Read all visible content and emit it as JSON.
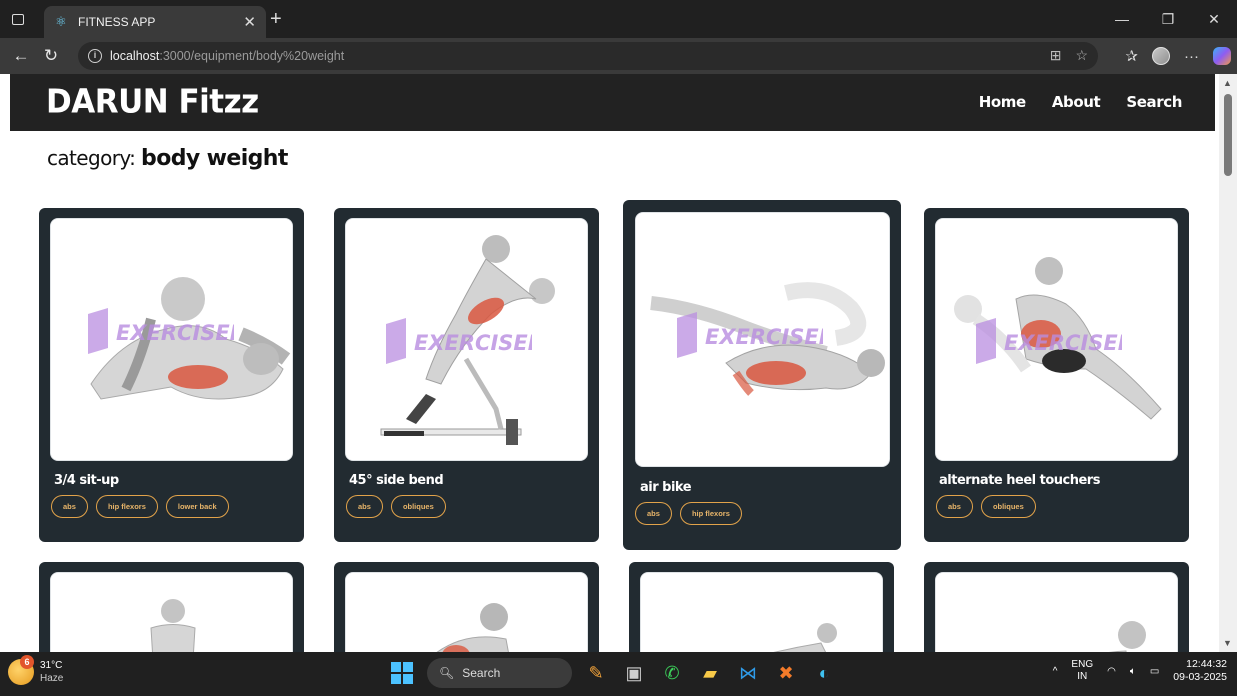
{
  "browser": {
    "tab_title": "FITNESS APP",
    "url_host": "localhost",
    "url_path": ":3000/equipment/body%20weight"
  },
  "app": {
    "brand": "DARUN Fitzz",
    "nav": [
      "Home",
      "About",
      "Search"
    ],
    "heading_prefix": "category:",
    "heading_value": "body weight",
    "watermark": "EXERCISEDB"
  },
  "cards": [
    {
      "name": "3/4 sit-up",
      "tags": [
        "abs",
        "hip flexors",
        "lower back"
      ]
    },
    {
      "name": "45° side bend",
      "tags": [
        "abs",
        "obliques"
      ]
    },
    {
      "name": "air bike",
      "tags": [
        "abs",
        "hip flexors"
      ]
    },
    {
      "name": "alternate heel touchers",
      "tags": [
        "abs",
        "obliques"
      ]
    }
  ],
  "taskbar": {
    "temperature": "31°C",
    "weather": "Haze",
    "weather_badge": "6",
    "search": "Search",
    "lang_top": "ENG",
    "lang_bottom": "IN",
    "time": "12:44:32",
    "date": "09-03-2025"
  },
  "colors": {
    "nav_bg": "#222222",
    "card_bg": "#222b31",
    "tag_border": "#e2a34a",
    "muscle_highlight": "#d9573f",
    "watermark": "#b98de0"
  },
  "icons": [
    "react-icon",
    "info-icon",
    "back-arrow-icon",
    "refresh-icon",
    "windows-icon",
    "search-icon"
  ]
}
